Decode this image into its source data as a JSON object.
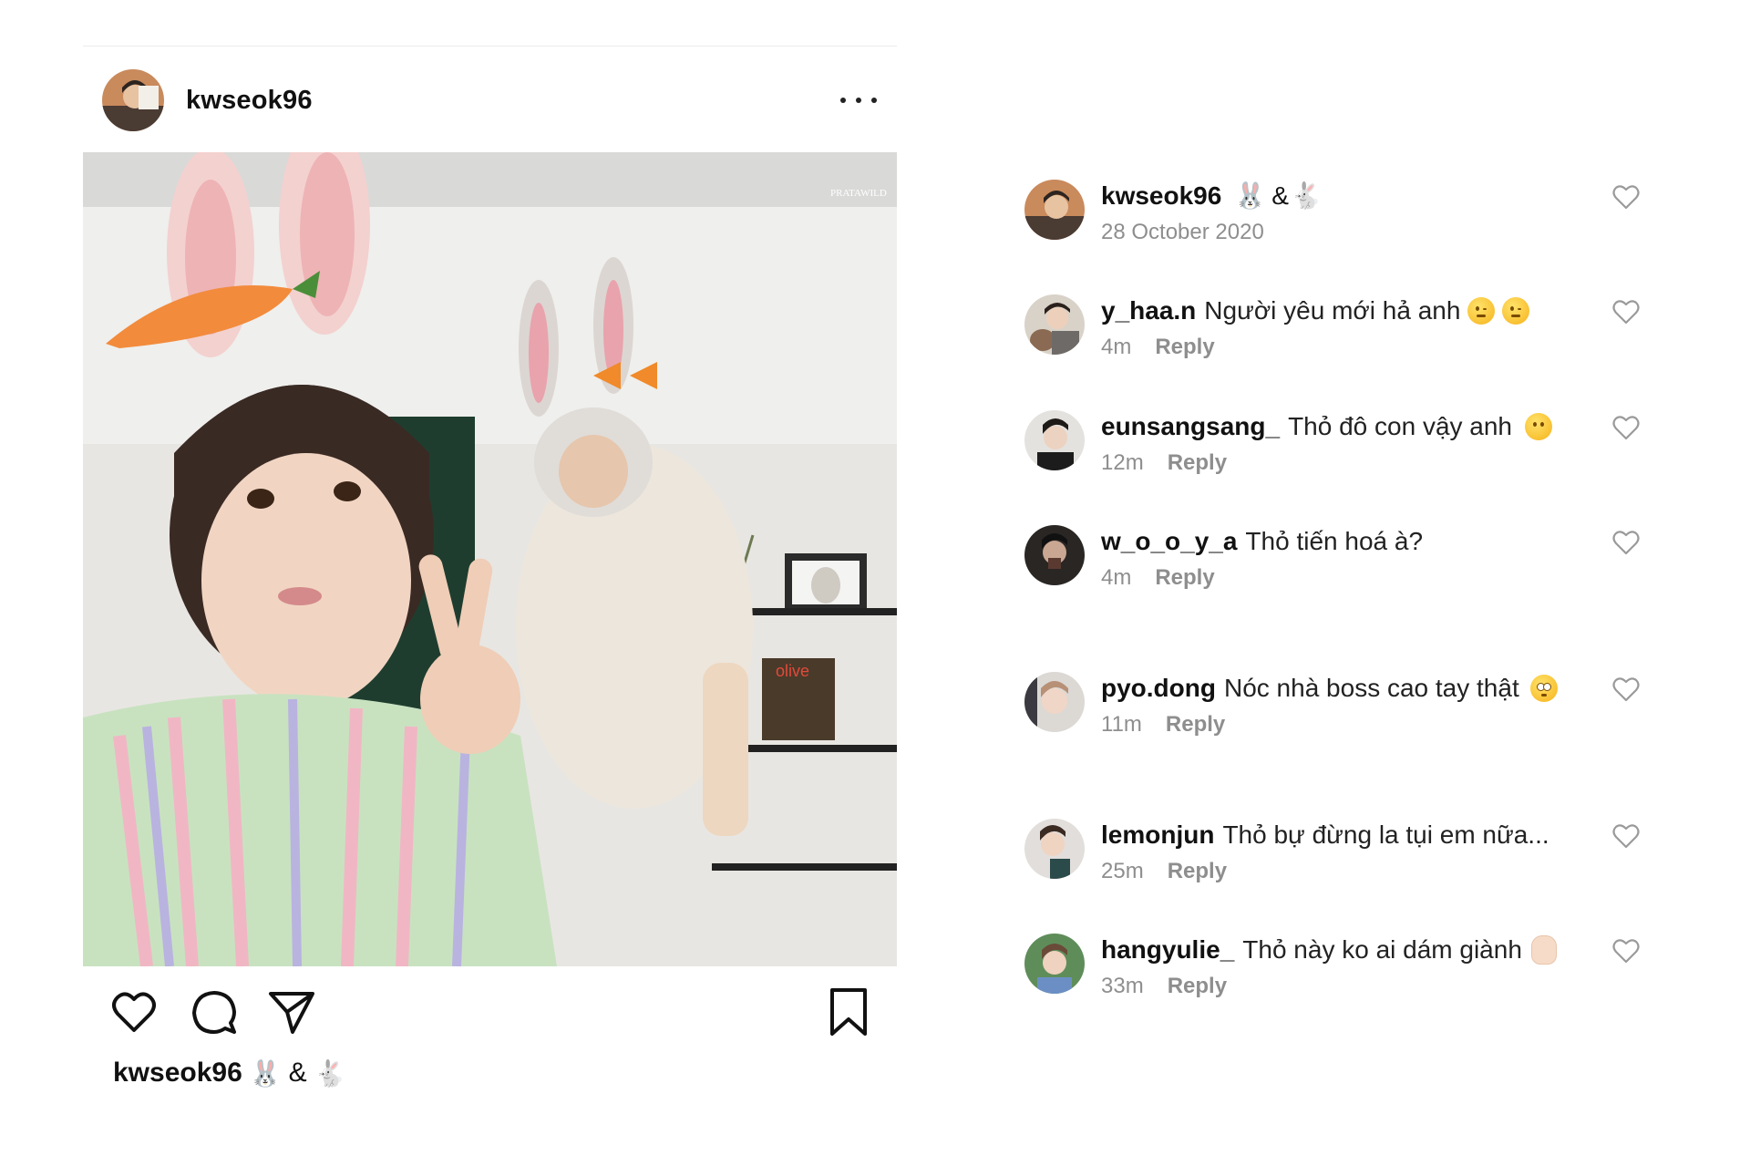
{
  "post": {
    "username": "kwseok96",
    "caption_user": "kwseok96",
    "caption_amp": "&",
    "caption_emoji_1": "🐰",
    "caption_emoji_2": "🐇",
    "photo_watermark": "PRATAWILD",
    "magazine_title": "olive"
  },
  "comments": [
    {
      "user": "kwseok96",
      "text": "",
      "emoji_1": "🐰",
      "amp": "&",
      "emoji_2": "🐇",
      "time": "28 October 2020",
      "reply": ""
    },
    {
      "user": "y_haa.n",
      "text": "Người yêu mới hả anh",
      "time": "4m",
      "reply": "Reply",
      "emoji": [
        "wink-face",
        "wink-face"
      ]
    },
    {
      "user": "eunsangsang_",
      "text": "Thỏ đô con vậy anh",
      "time": "12m",
      "reply": "Reply",
      "emoji": [
        "no-mouth-face"
      ]
    },
    {
      "user": "w_o_o_y_a",
      "text": "Thỏ tiến hoá à?",
      "time": "4m",
      "reply": "Reply",
      "emoji": []
    },
    {
      "user": "pyo.dong",
      "text": "Nóc nhà boss cao tay thật",
      "time": "11m",
      "reply": "Reply",
      "emoji": [
        "flushed-face"
      ]
    },
    {
      "user": "lemonjun",
      "text": "Thỏ bự đừng la tụi em nữa...",
      "time": "25m",
      "reply": "Reply",
      "emoji": []
    },
    {
      "user": "hangyulie_",
      "text": "Thỏ này ko ai dám giành",
      "time": "33m",
      "reply": "Reply",
      "emoji": [
        "ok-hand"
      ]
    }
  ],
  "icons": {
    "like": "heart-icon",
    "comment": "comment-bubble-icon",
    "share": "paper-plane-icon",
    "save": "bookmark-icon",
    "more": "ellipsis-icon"
  },
  "colors": {
    "text_primary": "#111111",
    "text_secondary": "#8e8e8e",
    "divider": "#ececec",
    "background": "#ffffff"
  }
}
